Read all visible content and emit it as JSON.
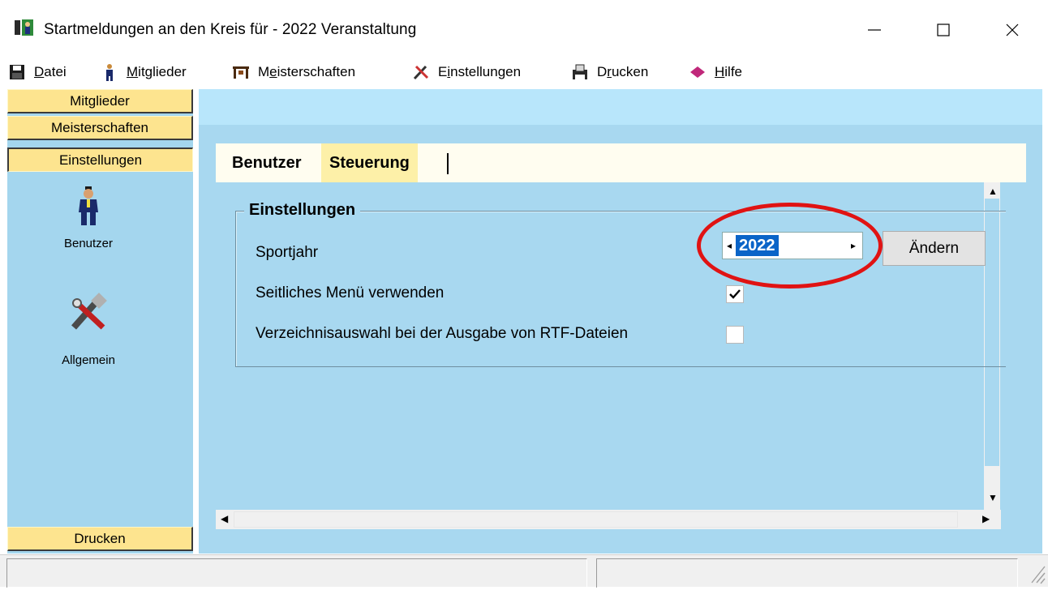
{
  "window": {
    "title": "Startmeldungen an den Kreis für   - 2022  Veranstaltung"
  },
  "menu": {
    "items": [
      {
        "label": "Datei",
        "mnemonic": "D",
        "rest": "atei",
        "icon": "floppy-disk-icon"
      },
      {
        "label": "Mitglieder",
        "mnemonic": "M",
        "rest": "itglieder",
        "icon": "person-icon"
      },
      {
        "label": "Meisterschaften",
        "pre": "M",
        "mnemonic": "e",
        "rest": "isterschaften",
        "icon": "podium-icon"
      },
      {
        "label": "Einstellungen",
        "pre": "E",
        "mnemonic": "i",
        "rest": "nstellungen",
        "icon": "tools-icon"
      },
      {
        "label": "Drucken",
        "pre": "D",
        "mnemonic": "r",
        "rest": "ucken",
        "icon": "printer-icon"
      },
      {
        "label": "Hilfe",
        "mnemonic": "H",
        "rest": "ilfe",
        "icon": "help-book-icon"
      }
    ]
  },
  "sidebar": {
    "sections": [
      "Mitglieder",
      "Meisterschaften",
      "Einstellungen",
      "Drucken"
    ],
    "tools": [
      {
        "label": "Benutzer",
        "icon": "user-icon"
      },
      {
        "label": "Allgemein",
        "icon": "tools-icon"
      }
    ]
  },
  "tabs": [
    "Benutzer",
    "Steuerung"
  ],
  "group": {
    "legend": "Einstellungen",
    "rows": [
      {
        "label": "Sportjahr"
      },
      {
        "label": "Seitliches Menü verwenden",
        "checked": true
      },
      {
        "label": "Verzeichnisauswahl bei der Ausgabe von RTF-Dateien",
        "checked": false
      }
    ],
    "year": "2022",
    "change_button": "Ändern"
  },
  "colors": {
    "accent": "#fde48f",
    "panel": "#a8d8f0",
    "selection": "#0a64c8",
    "highlight_ring": "#e01313"
  }
}
